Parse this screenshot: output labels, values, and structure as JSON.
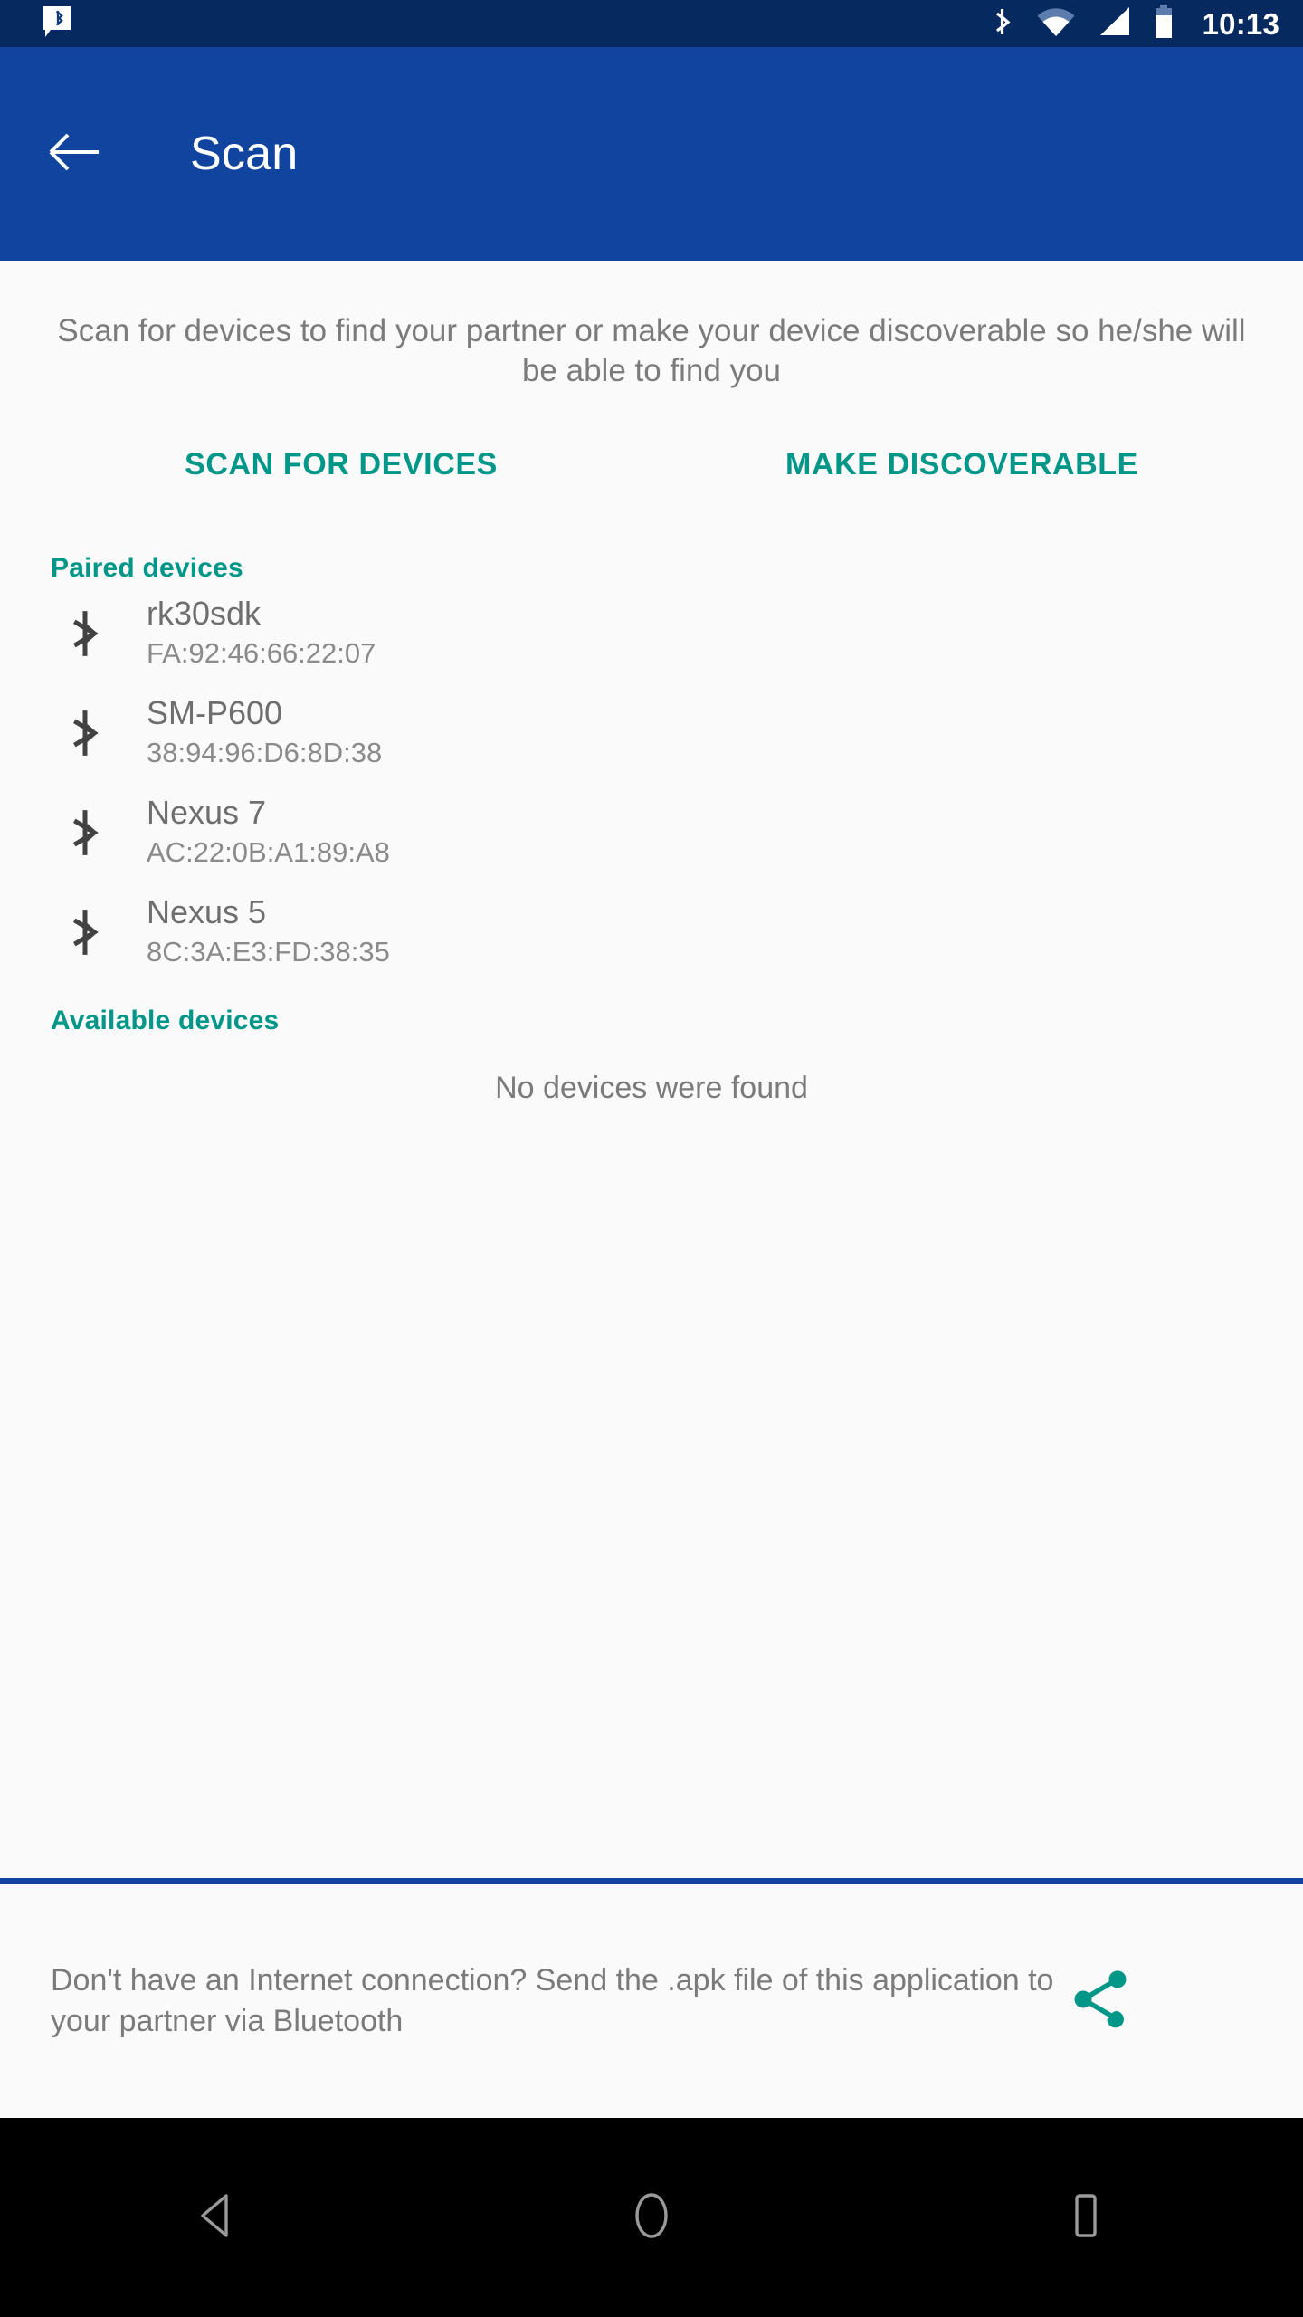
{
  "status_bar": {
    "notification_icon": "bluetooth-message-icon",
    "icons": [
      "bluetooth-icon",
      "wifi-icon",
      "cellular-signal-icon",
      "battery-icon"
    ],
    "time": "10:13",
    "background_color": "#062a5f"
  },
  "app_bar": {
    "back_icon": "back-arrow-icon",
    "title": "Scan",
    "background_color": "#11449f"
  },
  "content": {
    "description": "Scan for devices to find your partner or make your device discoverable so he/she will be able to find you",
    "actions": [
      {
        "label": "SCAN FOR DEVICES"
      },
      {
        "label": "MAKE DISCOVERABLE"
      }
    ],
    "paired_section": {
      "header": "Paired devices",
      "devices": [
        {
          "name": "rk30sdk",
          "mac": "FA:92:46:66:22:07",
          "icon": "bluetooth-icon"
        },
        {
          "name": "SM-P600",
          "mac": "38:94:96:D6:8D:38",
          "icon": "bluetooth-icon"
        },
        {
          "name": "Nexus 7",
          "mac": "AC:22:0B:A1:89:A8",
          "icon": "bluetooth-icon"
        },
        {
          "name": "Nexus 5",
          "mac": "8C:3A:E3:FD:38:35",
          "icon": "bluetooth-icon"
        }
      ]
    },
    "available_section": {
      "header": "Available devices",
      "empty_message": "No devices were found"
    },
    "accent_color": "#009688",
    "background_color": "#fafafa"
  },
  "footer": {
    "text": "Don't have an Internet connection? Send the .apk file of this application to your partner via Bluetooth",
    "share_icon": "share-icon",
    "divider_color": "#11449f"
  },
  "nav_bar": {
    "back_icon": "nav-back-triangle-icon",
    "home_icon": "nav-home-circle-icon",
    "recents_icon": "nav-recents-square-icon",
    "background_color": "#000000"
  }
}
